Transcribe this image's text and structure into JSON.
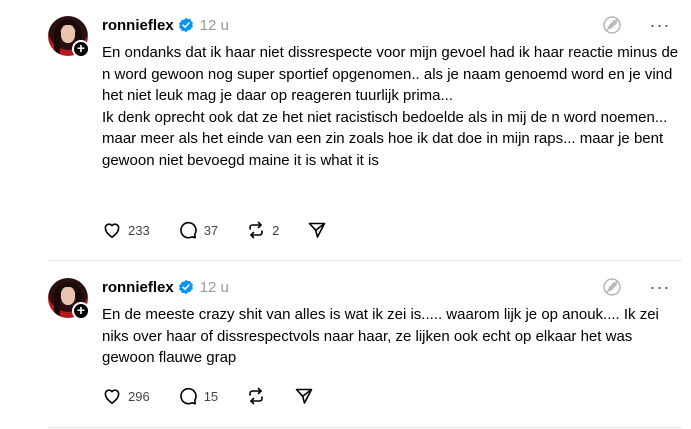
{
  "posts": [
    {
      "username": "ronnieflex",
      "time": "12 u",
      "text": "En ondanks dat ik haar niet dissrespecte voor mijn gevoel had ik haar reactie minus de n word gewoon nog super sportief opgenomen.. als je naam genoemd word en je vind het niet leuk mag je daar op reageren tuurlijk prima...\nIk denk oprecht ook dat ze het niet racistisch bedoelde als in mij de n word noemen... maar meer als het einde van een zin zoals hoe ik dat doe in mijn raps... maar je bent gewoon niet bevoegd maine it is what it is",
      "likes": "233",
      "replies": "37",
      "reposts": "2"
    },
    {
      "username": "ronnieflex",
      "time": "12 u",
      "text": "En de meeste crazy shit van alles is wat ik zei is..... waarom lijk je op anouk.... Ik zei niks over haar of dissrespectvols naar haar, ze lijken ook echt op elkaar het was gewoon flauwe grap",
      "likes": "296",
      "replies": "15",
      "reposts": ""
    }
  ],
  "colors": {
    "verified": "#0095f6",
    "muted": "#999999",
    "divider": "#e5e5e5"
  },
  "icons": {
    "like": "heart-icon",
    "reply": "comment-bubble-icon",
    "repost": "repost-icon",
    "share": "send-icon",
    "edit": "edit-disabled-icon",
    "more": "more-horizontal-icon"
  }
}
